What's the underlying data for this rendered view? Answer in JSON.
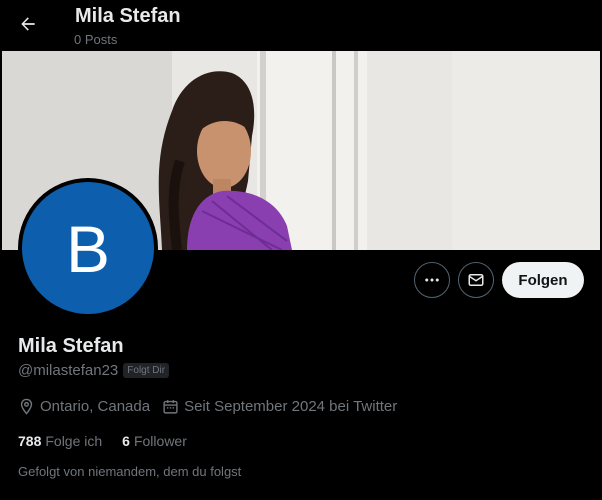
{
  "header": {
    "name": "Mila Stefan",
    "posts": "0 Posts"
  },
  "profile": {
    "avatar_letter": "B",
    "display_name": "Mila Stefan",
    "handle": "@milastefan23",
    "follows_you_badge": "Folgt Dir",
    "location": "Ontario, Canada",
    "joined": "Seit September 2024 bei Twitter",
    "following_count": "788",
    "following_label": "Folge ich",
    "followers_count": "6",
    "followers_label": "Follower",
    "followed_by": "Gefolgt von niemandem, dem du folgst"
  },
  "actions": {
    "follow_label": "Folgen"
  },
  "icons": {
    "back": "arrow-left-icon",
    "more": "more-horizontal-icon",
    "message": "envelope-icon",
    "location": "location-pin-icon",
    "calendar": "calendar-icon"
  },
  "colors": {
    "accent_avatar": "#0d5fae",
    "background": "#000000",
    "muted_text": "#71767b"
  }
}
